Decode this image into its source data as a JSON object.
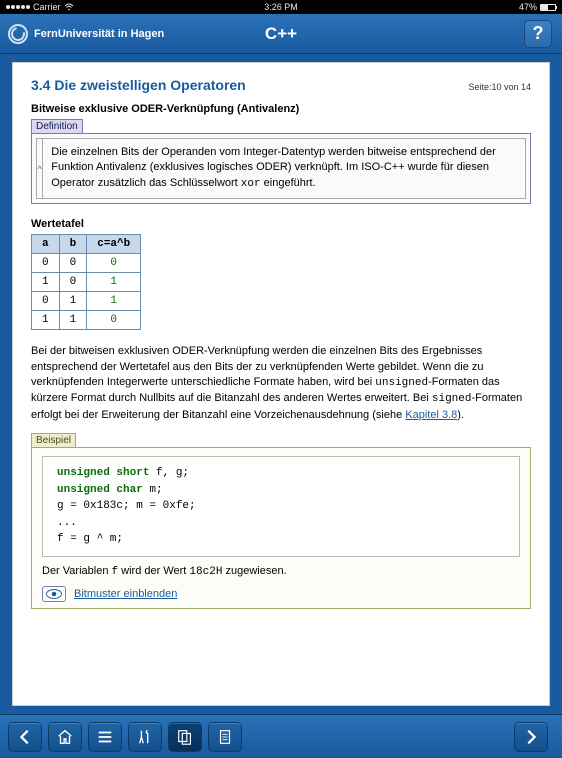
{
  "statusbar": {
    "carrier": "Carrier",
    "time": "3:26 PM",
    "battery": "47%"
  },
  "header": {
    "brand": "FernUniversität in Hagen",
    "title": "C++"
  },
  "section": {
    "title": "3.4 Die zweistelligen Operatoren",
    "page_label": "Seite:10 von 14"
  },
  "subtitle": "Bitweise exklusive ODER-Verknüpfung (Antivalenz)",
  "labels": {
    "definition": "Definition",
    "beispiel": "Beispiel",
    "wertetafel": "Wertetafel"
  },
  "definition": {
    "toggle": "^",
    "text_pre": "Die einzelnen Bits der Operanden vom Integer-Datentyp werden bitweise entsprechend der Funktion Antivalenz (exklusives logisches ODER) verknüpft. Im ISO-C++ wurde für diesen Operator zusätzlich das Schlüsselwort ",
    "keyword": "xor",
    "text_post": " eingeführt."
  },
  "table": {
    "headers": [
      "a",
      "b",
      "c=a^b"
    ],
    "rows": [
      [
        "0",
        "0",
        "0"
      ],
      [
        "1",
        "0",
        "1"
      ],
      [
        "0",
        "1",
        "1"
      ],
      [
        "1",
        "1",
        "0"
      ]
    ]
  },
  "para": {
    "p1": "Bei der bitweisen exklusiven ODER-Verknüpfung werden die einzelnen Bits des Ergebnisses entsprechend der Wertetafel aus den Bits der zu verknüpfenden Werte gebildet. Wenn die zu verknüpfenden Integerwerte unterschiedliche Formate haben, wird bei ",
    "c1": "unsigned",
    "p2": "-Formaten das kürzere Format durch Nullbits auf die Bitanzahl des anderen Wertes erweitert. Bei ",
    "c2": "signed",
    "p3": "-Formaten erfolgt bei der Erweiterung der Bitanzahl eine Vorzeichenausdehnung (siehe ",
    "link": "Kapitel 3.8",
    "p4": ")."
  },
  "code": {
    "l1a": "unsigned short",
    "l1b": " f, g;",
    "l2a": "unsigned char",
    "l2b": " m;",
    "l3": "g = 0x183c; m = 0xfe;",
    "l4": "...",
    "l5": "f = g ^ m;"
  },
  "beispiel_note": {
    "pre": "Der Variablen ",
    "var": "f",
    "mid": " wird der Wert ",
    "val": "18c2H",
    "post": " zugewiesen."
  },
  "eye_link": "Bitmuster einblenden"
}
